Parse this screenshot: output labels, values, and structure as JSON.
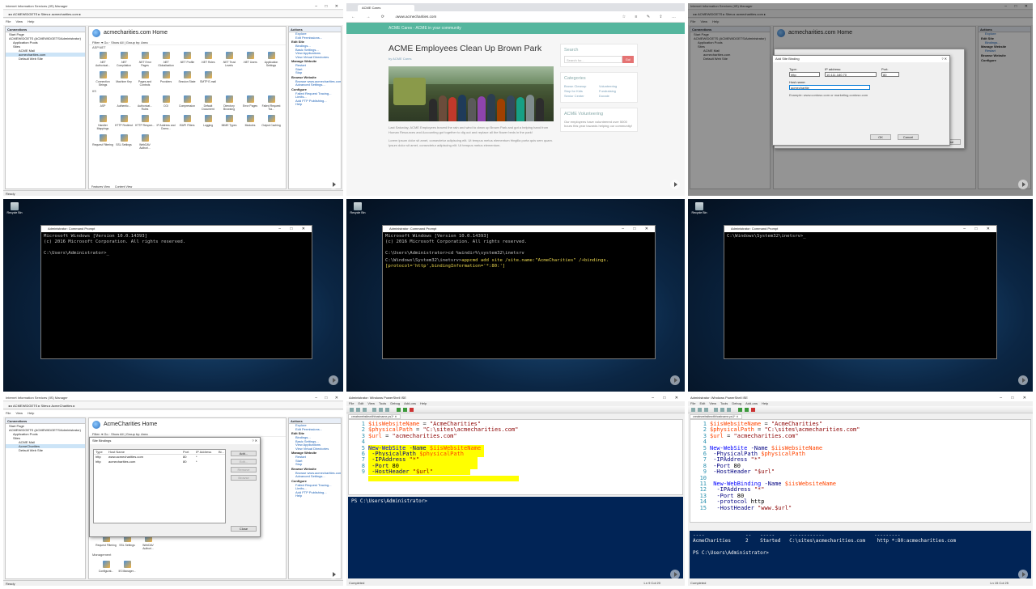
{
  "iis": {
    "title": "Internet Information Services (IIS) Manager",
    "win_controls": "– □ ✕",
    "path": "◂ ▸ ACMEWIDGETS ▸ Sites ▸ acmecharities.com ▸",
    "menu": [
      "File",
      "View",
      "Help"
    ],
    "connections_label": "Connections",
    "tree": [
      "Start Page",
      "ACMEWIDGETS (ACMEWIDGETS\\Administrator)",
      "Application Pools",
      "Sites",
      "ACME Mail",
      "acmecharities.com",
      "Default Web Site"
    ],
    "home_title": "acmecharities.com Home",
    "filter_row": "Filter:          ▾  Go  ·  Show All  |  Group by: Area",
    "sections": [
      "ASP.NET",
      "IIS",
      "Management"
    ],
    "aspnet_icons": [
      ".NET Authorizat...",
      ".NET Compilation",
      ".NET Error Pages",
      ".NET Globalization",
      ".NET Profile",
      ".NET Roles",
      ".NET Trust Levels",
      ".NET Users",
      "Application Settings",
      "Connection Strings",
      "Machine Key",
      "Pages and Controls",
      "Providers",
      "Session State",
      "SMTP E-mail"
    ],
    "iis_icons": [
      "ASP",
      "Authentic...",
      "Authorizat... Rules",
      "CGI",
      "Compression",
      "Default Document",
      "Directory Browsing",
      "Error Pages",
      "Failed Request Tra...",
      "Handler Mappings",
      "HTTP Redirect",
      "HTTP Respon...",
      "IP Address and Doma...",
      "ISAPI Filters",
      "Logging",
      "MIME Types",
      "Modules",
      "Output Caching",
      "Request Filtering",
      "SSL Settings",
      "WebDAV Authori..."
    ],
    "mgmt_icons": [
      "Configurat...",
      "IIS Manager..."
    ],
    "actions_label": "Actions",
    "actions": [
      {
        "group": "",
        "links": [
          "Explore",
          "Edit Permissions..."
        ]
      },
      {
        "group": "Edit Site",
        "links": [
          "Bindings...",
          "Basic Settings...",
          "View Applications",
          "View Virtual Directories"
        ]
      },
      {
        "group": "Manage Website",
        "links": [
          "Restart",
          "Start",
          "Stop"
        ]
      },
      {
        "group": "Browse Website",
        "links": [
          "Browse www.acmecharities.com on *:80 (http)",
          "Advanced Settings..."
        ]
      },
      {
        "group": "Configure",
        "links": [
          "Failed Request Tracing...",
          "Limits...",
          "Add FTP Publishing..."
        ]
      },
      {
        "group": "",
        "links": [
          "Help"
        ]
      }
    ],
    "view_tabs": [
      "Features View",
      "Content View"
    ],
    "status": "Ready",
    "home_title_2": "acmecharities.com Home",
    "path_2": "◂ ▸ ACMEWIDGETS ▸ Sites ▸ acmecharities.com ▸",
    "path_7": "◂ ▸ ACMEWIDGETS ▸ Sites ▸ AcmeCharities ▸",
    "tree_7": [
      "Start Page",
      "ACMEWIDGETS (ACMEWIDGETS\\Administrator)",
      "Application Pools",
      "Sites",
      "ACME Mail",
      "AcmeCharities",
      "Default Web Site"
    ],
    "home_title_7": "AcmeCharities Home"
  },
  "browser": {
    "tab_title": "ACME Cares",
    "url": "www.acmecharities.com",
    "nav_icons": "← → ⟳ ⌂",
    "right_icons": "☆ ≡ ✎ ⇪ …",
    "site_tagline": "ACME Cares - ACME in your community",
    "headline": "ACME Employees Clean Up Brown Park",
    "byline": "by ACME Cares",
    "paragraph1": "Last Saturday, ACME Employees braved the rain and wind to clean up Brown Park and got a helping hand from Human Resources and Accounting got together to dig out and replace all the flower beds in the park!",
    "paragraph2": "Lorem ipsum dolor sit amet, consectetur adipiscing elit. Ut tempus metus elementum fringilla porta quis sem quam. Ipsum dolor sit amet, consectetur adipiscing elit. Ut tempus metus elementum.",
    "search_title": "Search",
    "search_placeholder": "Search for...",
    "search_go": "Go!",
    "categories_title": "Categories",
    "categories": [
      "Brown Cleanup",
      "Volunteering",
      "Stop for Kids",
      "Fundraising",
      "Senior Center",
      "Donate"
    ],
    "volunteer_title": "ACME Volunteering",
    "volunteer_text": "Our employees have volunteered over 5000 hours this year towards helping our community!"
  },
  "binding_dialog": {
    "title": "Add Site Binding",
    "close_glyph": "?   ✕",
    "type_label": "Type:",
    "type_value": "http",
    "ip_label": "IP address:",
    "ip_value": "10.111.180.70",
    "port_label": "Port:",
    "port_value": "80",
    "host_label": "Host name:",
    "host_value": "acmecharitie",
    "example": "Example: www.contoso.com or marketing.contoso.com",
    "ok": "OK",
    "cancel": "Cancel",
    "behind_close": "Close"
  },
  "cmd": {
    "recycle_label": "Recycle Bin",
    "title": "Administrator: Command Prompt",
    "win_controls": "– □ ✕",
    "banner1": "Microsoft Windows [Version 10.0.14393]",
    "banner2": "(c) 2016 Microsoft Corporation. All rights reserved.",
    "prompt1": "C:\\Users\\Administrator>_",
    "prompt2a": "C:\\Users\\Administrator>cd %windir%\\system32\\inetsrv",
    "prompt2b": "C:\\Windows\\System32\\inetsrv>",
    "command2": "appcmd add site /site.name:\"AcmeCharities\" /+bindings.[protocol='http',bindingInformation='*:80:']",
    "prompt3": "C:\\Windows\\System32\\inetsrv>_"
  },
  "site_bindings": {
    "title": "Site Bindings",
    "title_glyphs": "?   ✕",
    "columns": [
      "Type",
      "Host Name",
      "Port",
      "IP Address",
      "Bi..."
    ],
    "rows": [
      {
        "type": "http",
        "host": "www.acmecharities.com",
        "port": "80",
        "ip": "*"
      },
      {
        "type": "http",
        "host": "acmecharities.com",
        "port": "80",
        "ip": "*"
      }
    ],
    "buttons": [
      "Add...",
      "Edit...",
      "Remove",
      "Browse"
    ],
    "close": "Close"
  },
  "ise": {
    "title": "Administrator: Windows PowerShell ISE",
    "win_controls": "– □ ✕",
    "menu": [
      "File",
      "Edit",
      "View",
      "Tools",
      "Debug",
      "Add-ons",
      "Help"
    ],
    "tab_a": "createwebsitewithhostname.ps1* ✕",
    "tab_b": "createwebsitewithhostname.ps1* ✕",
    "console_prompt_a": "PS C:\\Users\\Administrator>",
    "console_header_b": "----              --   -----     ------------                 ---------",
    "console_row_b": "AcmeCharities     2    Started   C:\\sites\\acmecharities.com    http *:80:acmecharities.com",
    "console_prompt_b": "PS C:\\Users\\Administrator>",
    "status_left": "Completed",
    "pos_a": "Ln 9  Col 20",
    "pos_b": "Ln 15  Col 25",
    "lines": {
      "n1": "1",
      "n2": "2",
      "n3": "3",
      "n4": "4",
      "n5": "5",
      "n6": "6",
      "n7": "7",
      "n8": "8",
      "n9": "9",
      "n10": "10",
      "n11": "11",
      "n12": "12",
      "n13": "13",
      "n14": "14",
      "n15": "15",
      "v_name": "$iisWebsiteName",
      "s_name": "\"AcmeCharities\"",
      "v_path": "$physicalPath",
      "s_path": "\"C:\\sites\\acmecharities.com\"",
      "v_url": "$url",
      "s_url": "\"acmecharities.com\"",
      "eq": "=",
      "c_new": "New-WebSite",
      "p_name": "-Name",
      "p_phys": "-PhysicalPath",
      "p_ip": "-IPAddress",
      "s_star": "\"*\"",
      "p_port": "-Port",
      "n80": "80",
      "p_host": "-HostHeader",
      "s_hosturl": "\"$url\"",
      "c_bind": "New-WebBinding",
      "p_proto": "-protocol",
      "w_http": "http",
      "s_www": "\"www.$url\""
    }
  }
}
